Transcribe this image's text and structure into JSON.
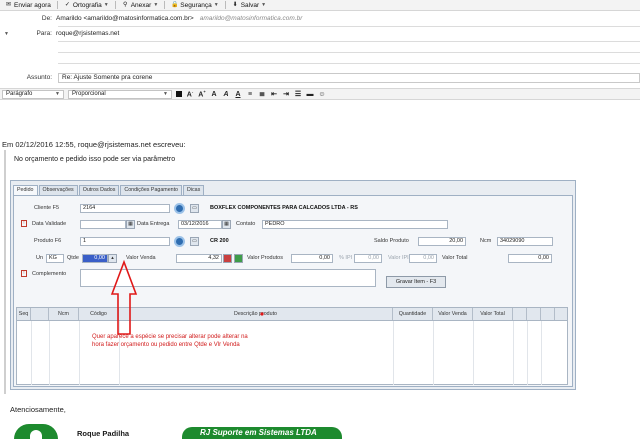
{
  "toolbar": {
    "send": "Enviar agora",
    "spelling": "Ortografia",
    "attach": "Anexar",
    "security": "Segurança",
    "save": "Salvar"
  },
  "header": {
    "from_label": "De:",
    "from_value": "Amarildo <amarildo@matosinformatica.com.br>",
    "from_secondary": "amarildo@matosinformatica.com.br",
    "to_label": "Para:",
    "to_value": "roque@rjsistemas.net",
    "subject_label": "Assunto:",
    "subject_value": "Re: Ajuste Somente pra corene"
  },
  "format": {
    "paragraph": "Parágrafo",
    "font": "Proporcional"
  },
  "body": {
    "reply_line": "Em 02/12/2016 12:55, roque@rjsistemas.net escreveu:",
    "quote_text": "No orçamento e pedido isso pode ser via parâmetro",
    "annotation": "Quer aparece a espécie se precisar alterar pode alterar na hora fazer orçamento ou pedido entre Qtde e Vlr Venda",
    "closing": "Atenciosamente,",
    "sig_name": "Roque Padilha",
    "sig_company": "RJ Suporte em Sistemas LTDA"
  },
  "app": {
    "tabs": [
      "Pedido",
      "Observações",
      "Outros Dados",
      "Condições Pagamento",
      "Dicas"
    ],
    "cliente_label": "Cliente F5",
    "cliente_code": "2164",
    "cliente_name": "BOXFLEX COMPONENTES PARA CALCADOS LTDA - RS",
    "validade_label": "Data Validade",
    "entrega_label": "Data Entrega",
    "entrega_value": "03/12/2016",
    "contato_label": "Contato",
    "contato_value": "PEDRO",
    "produto_label": "Produto F6",
    "produto_code": "1",
    "produto_name": "CR 200",
    "saldo_label": "Saldo Produto",
    "saldo_value": "20,00",
    "ncm_label": "Ncm",
    "ncm_value": "34029090",
    "un_label": "Un",
    "un_value": "KG",
    "qtde_label": "Qtde",
    "qtde_value": "0,00",
    "valor_venda_label": "Valor Venda",
    "valor_venda_value": "4,32",
    "valor_produtos_label": "Valor Produtos",
    "valor_produtos_value": "0,00",
    "icms_label": "% IPI",
    "icms_value": "0,00",
    "ipi_label": "Valor IPI",
    "ipi_value": "0,00",
    "total_label": "Valor Total",
    "total_value": "0,00",
    "complemento_label": "Complemento",
    "gravar_button": "Gravar Item - F3",
    "grid_cols": [
      "Seq",
      "Ncm",
      "Código",
      "Descrição produto",
      "Quantidade",
      "Valor Venda",
      "Valor Total"
    ]
  }
}
